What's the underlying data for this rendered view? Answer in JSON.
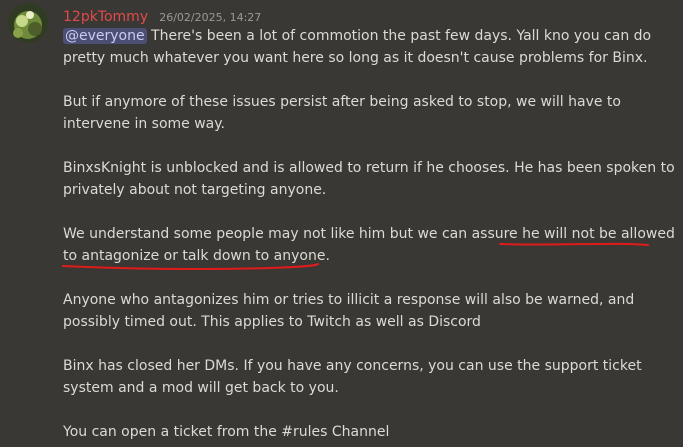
{
  "message": {
    "username": "12pkTommy",
    "timestamp": "26/02/2025, 14:27",
    "mention": "@everyone",
    "lines": [
      " There's been a lot of commotion the past few days. Yall kno you can do",
      "pretty much whatever you want here so long as it doesn't cause problems for Binx.",
      "But if anymore of these issues persist after being asked to stop, we will have to",
      "intervene in some way.",
      "BinxsKnight is unblocked and is allowed to return if he chooses. He has been spoken to",
      "privately about not targeting anyone.",
      "We understand some people may not like him but we can assure he will not be allowed",
      "to antagonize or talk down to anyone.",
      "Anyone who antagonizes him or tries to illicit a response will also be warned, and",
      "possibly timed out. This applies to Twitch as well as Discord",
      "Binx has closed her DMs. If you have any concerns, you can use the support ticket",
      "system and a mod will get back to you.",
      "You can open a ticket from the #rules Channel"
    ]
  },
  "colors": {
    "background": "#393834",
    "username": "#e24a4a",
    "mention_bg": "#4b4f73",
    "annotation": "#e01b1b"
  },
  "icons": {
    "avatar": "avatar-image"
  }
}
